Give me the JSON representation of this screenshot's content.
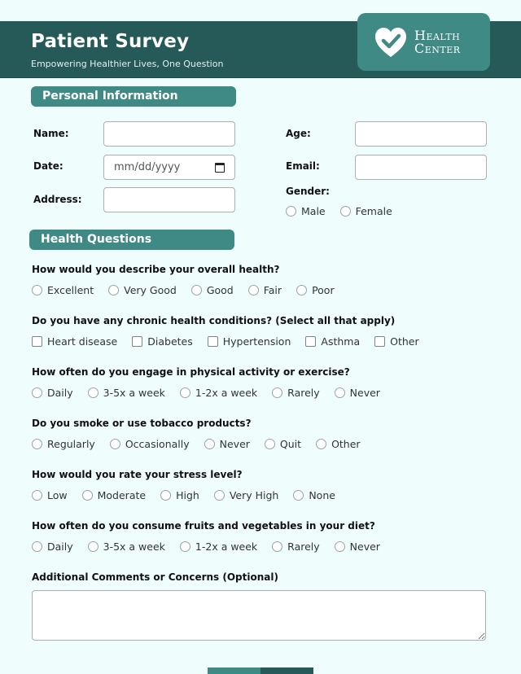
{
  "header": {
    "title": "Patient Survey",
    "subtitle": "Empowering Healthier Lives, One Question",
    "logo": {
      "line1": "Health",
      "line2": "Center",
      "icon": "heart-check-icon"
    }
  },
  "colors": {
    "primary_dark": "#255a58",
    "primary": "#408a85",
    "background": "#effdfd"
  },
  "personal": {
    "heading": "Personal Information",
    "name_label": "Name:",
    "name_value": "",
    "date_label": "Date:",
    "date_placeholder": "mm/dd/yyyy",
    "address_label": "Address:",
    "address_value": "",
    "age_label": "Age:",
    "age_value": "",
    "email_label": "Email:",
    "email_value": "",
    "gender_label": "Gender:",
    "gender_options": [
      "Male",
      "Female"
    ]
  },
  "health": {
    "heading": "Health Questions",
    "questions": [
      {
        "text": "How would you describe your overall health?",
        "type": "radio",
        "options": [
          "Excellent",
          "Very Good",
          "Good",
          "Fair",
          "Poor"
        ]
      },
      {
        "text": "Do you have any chronic health conditions? (Select all that apply)",
        "type": "checkbox",
        "options": [
          "Heart disease",
          "Diabetes",
          "Hypertension",
          "Asthma",
          "Other"
        ]
      },
      {
        "text": "How often do you engage in physical activity or exercise?",
        "type": "radio",
        "options": [
          "Daily",
          "3-5x a week",
          "1-2x a week",
          "Rarely",
          "Never"
        ]
      },
      {
        "text": "Do you smoke or use tobacco products?",
        "type": "radio",
        "options": [
          "Regularly",
          "Occasionally",
          "Never",
          "Quit",
          "Other"
        ]
      },
      {
        "text": "How would you rate your stress level?",
        "type": "radio",
        "options": [
          "Low",
          "Moderate",
          "High",
          "Very High",
          "None"
        ]
      },
      {
        "text": "How often do you consume fruits and vegetables in your diet?",
        "type": "radio",
        "options": [
          "Daily",
          "3-5x a week",
          "1-2x a week",
          "Rarely",
          "Never"
        ]
      }
    ],
    "comments_label": "Additional Comments or Concerns (Optional)",
    "comments_value": ""
  }
}
